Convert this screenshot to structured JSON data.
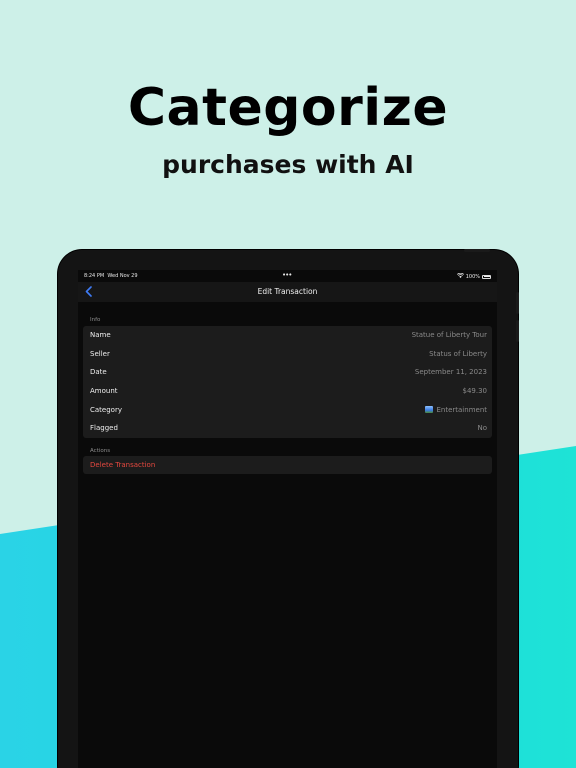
{
  "promo": {
    "headline": "Categorize",
    "subhead": "purchases with AI"
  },
  "status_bar": {
    "time": "8:24 PM",
    "date": "Wed Nov 29",
    "battery": "100%"
  },
  "nav": {
    "title": "Edit Transaction"
  },
  "info_section": {
    "label": "Info",
    "rows": [
      {
        "label": "Name",
        "value": "Statue of Liberty Tour"
      },
      {
        "label": "Seller",
        "value": "Status of Liberty"
      },
      {
        "label": "Date",
        "value": "September 11, 2023"
      },
      {
        "label": "Amount",
        "value": "$49.30"
      },
      {
        "label": "Category",
        "value": "Entertainment",
        "icon": "image-icon"
      },
      {
        "label": "Flagged",
        "value": "No"
      }
    ]
  },
  "actions_section": {
    "label": "Actions",
    "delete_label": "Delete Transaction"
  },
  "colors": {
    "accent": "#3f7bf5",
    "destructive": "#e5483f",
    "background_mint": "#cdf0e8",
    "background_teal": "#1ed9df"
  }
}
